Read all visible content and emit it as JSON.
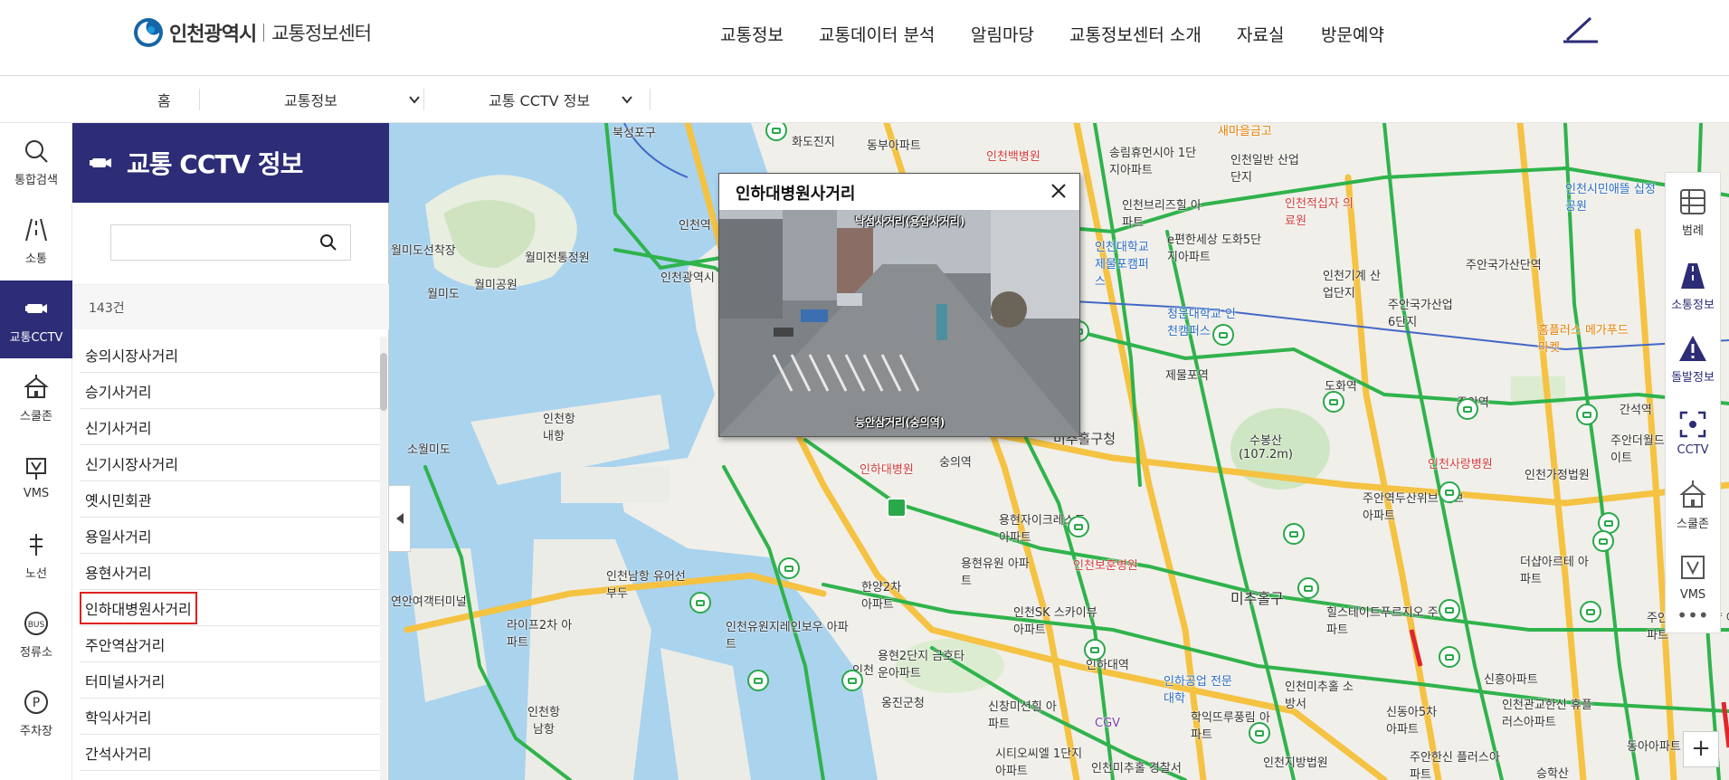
{
  "header": {
    "logo_city": "인천광역시",
    "logo_center": "교통정보센터",
    "nav": [
      "교통정보",
      "교통데이터 분석",
      "알림마당",
      "교통정보센터 소개",
      "자료실",
      "방문예약"
    ],
    "menu_icon": "hamburger-slash-icon"
  },
  "breadcrumb": {
    "home": "홈",
    "level1": "교통정보",
    "level2": "교통 CCTV 정보"
  },
  "rail": [
    {
      "label": "통합검색",
      "icon": "search-icon"
    },
    {
      "label": "소통",
      "icon": "road-icon"
    },
    {
      "label": "교통CCTV",
      "icon": "cctv-icon"
    },
    {
      "label": "스쿨존",
      "icon": "school-icon"
    },
    {
      "label": "VMS",
      "icon": "vms-icon"
    },
    {
      "label": "노선",
      "icon": "route-icon"
    },
    {
      "label": "정류소",
      "icon": "bus-stop-icon"
    },
    {
      "label": "주차장",
      "icon": "parking-icon"
    }
  ],
  "panel": {
    "title": "교통 CCTV 정보",
    "search_placeholder": "",
    "count": "143건",
    "items": [
      "숭의시장사거리",
      "승기사거리",
      "신기사거리",
      "신기시장사거리",
      "옛시민회관",
      "용일사거리",
      "용현사거리",
      "인하대병원사거리",
      "주안역삼거리",
      "터미널사거리",
      "학익사거리",
      "간석사거리"
    ],
    "selected": "인하대병원사거리"
  },
  "popup": {
    "title": "인하대병원사거리",
    "caption_top": "낙섬사거리(용암사거리)",
    "caption_bottom": "능안삼거리(숭의역)"
  },
  "tools": [
    {
      "label": "범례",
      "icon": "legend-icon"
    },
    {
      "label": "소통정보",
      "icon": "traffic-road-icon"
    },
    {
      "label": "돌발정보",
      "icon": "warning-icon"
    },
    {
      "label": "CCTV",
      "icon": "cctv-focus-icon"
    },
    {
      "label": "스쿨존",
      "icon": "school-icon"
    },
    {
      "label": "VMS",
      "icon": "vms-icon"
    }
  ],
  "more": "•••",
  "zoom_in": "+",
  "map_labels": {
    "l1": "북성포구",
    "l2": "화도진지",
    "l3": "동부아파트",
    "l4": "인천백병원",
    "l5": "송림휴먼시아 1단지아파트",
    "l6": "인천일반 산업단지",
    "l7": "인천적십자 의료원",
    "l8": "인천역",
    "l9": "월미도선착장",
    "l10": "월미전통정원",
    "l11": "월미공원",
    "l12": "월미도",
    "l13": "인천광역시",
    "l14": "인천브리즈힐 아파트",
    "l15": "e편한세상 도화5단지아파트",
    "l16": "인천대학교 제물포캠퍼스",
    "l17": "청운대학교 인천캠퍼스",
    "l18": "인천기계 산업단지",
    "l19": "주안국가산업 6단지",
    "l20": "주안국가산단역",
    "l21": "인천시민애뜰 십정공원",
    "l22": "홈플러스 메가푸드마켓",
    "l23": "인천항 내항",
    "l24": "소월미도",
    "l25": "제물포역",
    "l26": "도화역",
    "l27": "주안역",
    "l28": "간석역",
    "l29": "미추홀구청",
    "l30": "수봉산 (107.2m)",
    "l31": "인천사랑병원",
    "l32": "인천가정법원",
    "l33": "주안더월드 스테이트",
    "l34": "인하대병원",
    "l35": "용현자이크레스트 아파트",
    "l36": "용현유원 아파트",
    "l37": "인천보훈병원",
    "l38": "주안역두산위브 리브아파트",
    "l39": "인천남항 유어선부두",
    "l40": "라이프2차 아파트",
    "l41": "연안여객터미널",
    "l42": "인천SK 스카이뷰아파트",
    "l43": "미추홀구",
    "l44": "힐스테이트푸르지오 주안아파트",
    "l45": "더샵아르테 아파트",
    "l46": "인하대역",
    "l47": "인하공업 전문대학",
    "l48": "인천미추홀 소방서",
    "l49": "신동아5차 아파트",
    "l50": "인천관교한신 휴플러스아파트",
    "l51": "용현2단지 금호타운아파트",
    "l52": "옹진군청",
    "l53": "신창미션힐 아파트",
    "l54": "학익뜨루풍림 아파트",
    "l55": "인천항 남항",
    "l56": "시티오씨엘 1단지아파트",
    "l57": "인천미추홀 경찰서",
    "l58": "주안한신 플러스아파트",
    "l59": "숭의역",
    "l60": "인천유원지레인보우 아파트",
    "l61": "새마을금고",
    "l62": "한양2차 아파트",
    "l63": "인천",
    "l64": "CGV",
    "l65": "인천지방법원",
    "l66": "승학산",
    "l67": "동아아파트",
    "l68": "신동아5차",
    "l69": "주안캐슬앤더샵 아파트",
    "l70": "신흥아파트"
  }
}
